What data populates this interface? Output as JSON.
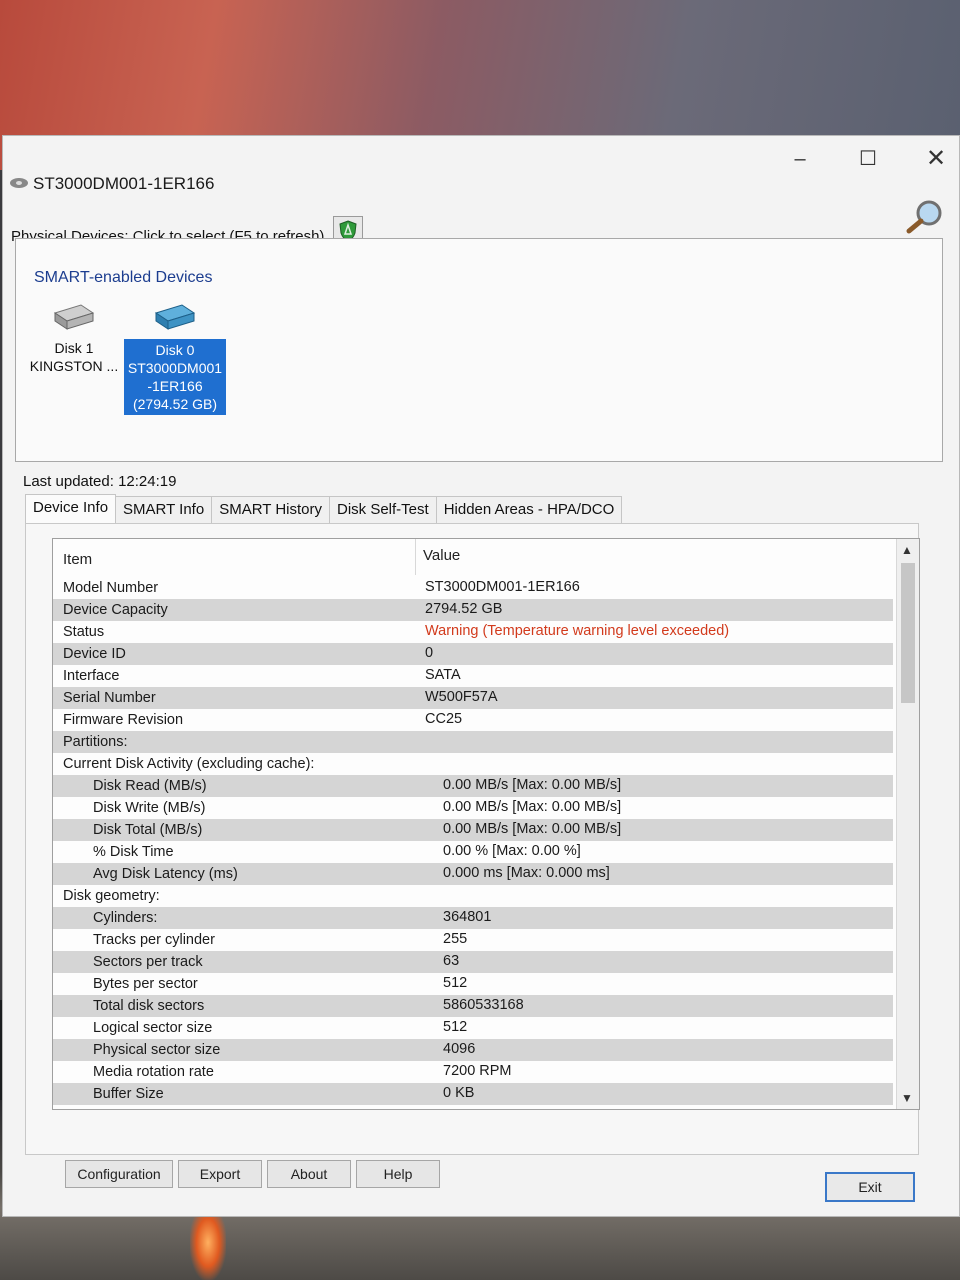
{
  "window": {
    "title": "ST3000DM001-1ER166",
    "controls": {
      "minimize": "–",
      "maximize": "☐",
      "close": "✕"
    }
  },
  "toolbar": {
    "physical_devices_label": "Physical Devices: Click to select (F5 to refresh)",
    "shield_icon": "shield-icon",
    "magnifier_icon": "magnifier-icon"
  },
  "devices_panel": {
    "title": "SMART-enabled Devices",
    "devices": [
      {
        "line1": "Disk 1",
        "line2": "KINGSTON ...",
        "selected": false
      },
      {
        "line1": "Disk 0",
        "line2": "ST3000DM001",
        "line3": "-1ER166",
        "line4": "(2794.52 GB)",
        "selected": true
      }
    ]
  },
  "last_updated": "Last updated: 12:24:19",
  "tabs": [
    "Device Info",
    "SMART Info",
    "SMART History",
    "Disk Self-Test",
    "Hidden Areas - HPA/DCO"
  ],
  "active_tab": "Device Info",
  "grid": {
    "header_item": "Item",
    "header_value": "Value",
    "rows": [
      {
        "item": "Model Number",
        "value": "ST3000DM001-1ER166",
        "indent": 0
      },
      {
        "item": "Device Capacity",
        "value": "2794.52 GB",
        "indent": 0
      },
      {
        "item": "Status",
        "value": "Warning (Temperature warning level exceeded)",
        "indent": 0,
        "warn": true
      },
      {
        "item": "Device ID",
        "value": "0",
        "indent": 0
      },
      {
        "item": "Interface",
        "value": "SATA",
        "indent": 0
      },
      {
        "item": "Serial Number",
        "value": "W500F57A",
        "indent": 0
      },
      {
        "item": "Firmware Revision",
        "value": "CC25",
        "indent": 0
      },
      {
        "item": "Partitions:",
        "value": "",
        "indent": 0
      },
      {
        "item": "Current Disk Activity (excluding cache):",
        "value": "",
        "indent": 0
      },
      {
        "item": "Disk Read (MB/s)",
        "value": "0.00 MB/s [Max: 0.00 MB/s]",
        "indent": 1
      },
      {
        "item": "Disk Write (MB/s)",
        "value": "0.00 MB/s [Max: 0.00 MB/s]",
        "indent": 1
      },
      {
        "item": "Disk Total (MB/s)",
        "value": "0.00 MB/s [Max: 0.00 MB/s]",
        "indent": 1
      },
      {
        "item": "% Disk Time",
        "value": "0.00 %    [Max: 0.00 %]",
        "indent": 1
      },
      {
        "item": "Avg Disk Latency (ms)",
        "value": "0.000 ms  [Max: 0.000 ms]",
        "indent": 1
      },
      {
        "item": "Disk geometry:",
        "value": "",
        "indent": 0
      },
      {
        "item": "Cylinders:",
        "value": "364801",
        "indent": 1
      },
      {
        "item": "Tracks per cylinder",
        "value": "255",
        "indent": 1
      },
      {
        "item": "Sectors per track",
        "value": "63",
        "indent": 1
      },
      {
        "item": "Bytes per sector",
        "value": "512",
        "indent": 1
      },
      {
        "item": "Total disk sectors",
        "value": "5860533168",
        "indent": 1
      },
      {
        "item": "Logical sector size",
        "value": "512",
        "indent": 1
      },
      {
        "item": "Physical sector size",
        "value": "4096",
        "indent": 1
      },
      {
        "item": "Media rotation rate",
        "value": "7200 RPM",
        "indent": 1
      },
      {
        "item": "Buffer Size",
        "value": "0 KB",
        "indent": 1
      }
    ]
  },
  "buttons": {
    "configuration": "Configuration",
    "export": "Export",
    "about": "About",
    "help": "Help",
    "exit": "Exit"
  },
  "colors": {
    "selection": "#1f6fd0",
    "warning_text": "#d23a1c",
    "section_title": "#1c3d8f",
    "row_shade": "#d5d5d5"
  }
}
